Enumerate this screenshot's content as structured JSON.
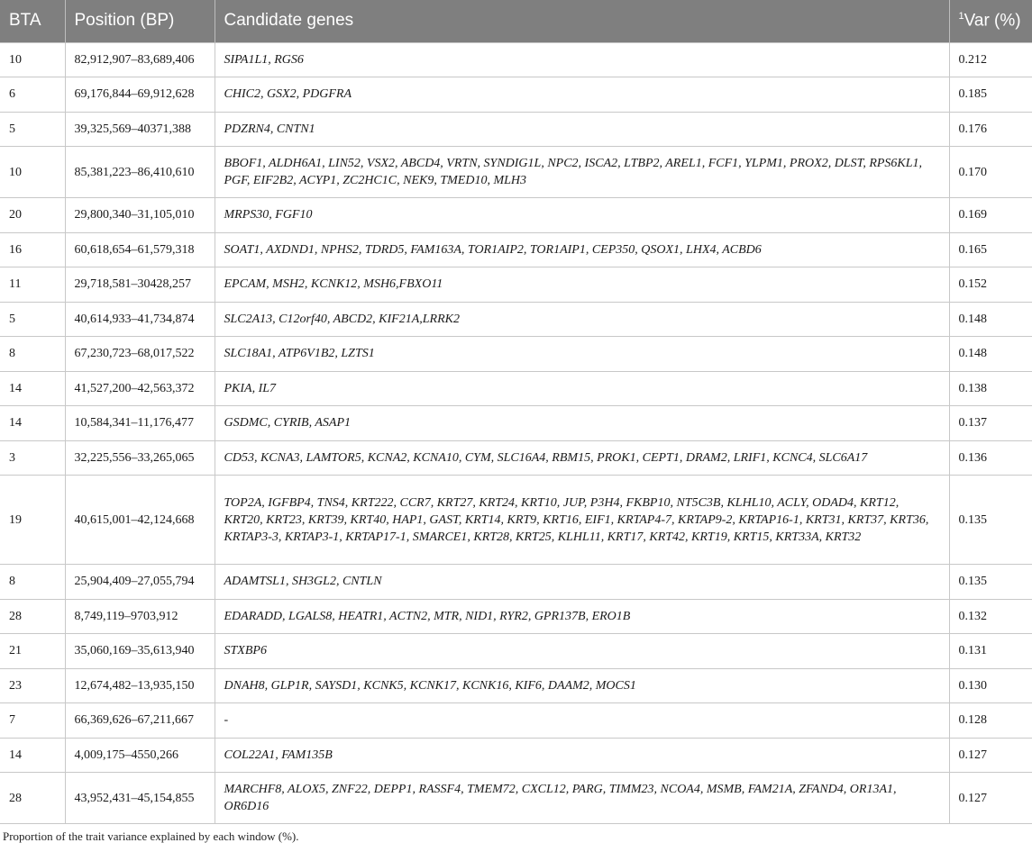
{
  "table": {
    "headers": {
      "bta": "BTA",
      "position": "Position (BP)",
      "genes": "Candidate genes",
      "var_sup": "1",
      "var": "Var (%)"
    },
    "rows": [
      {
        "bta": "10",
        "position": "82,912,907–83,689,406",
        "genes": "SIPA1L1, RGS6",
        "var": "0.212"
      },
      {
        "bta": "6",
        "position": "69,176,844–69,912,628",
        "genes": "CHIC2, GSX2, PDGFRA",
        "var": "0.185"
      },
      {
        "bta": "5",
        "position": "39,325,569–40371,388",
        "genes": "PDZRN4, CNTN1",
        "var": "0.176"
      },
      {
        "bta": "10",
        "position": "85,381,223–86,410,610",
        "genes": "BBOF1, ALDH6A1, LIN52, VSX2, ABCD4, VRTN, SYNDIG1L, NPC2, ISCA2, LTBP2, AREL1, FCF1, YLPM1, PROX2, DLST, RPS6KL1, PGF, EIF2B2, ACYP1, ZC2HC1C, NEK9, TMED10, MLH3",
        "var": "0.170"
      },
      {
        "bta": "20",
        "position": "29,800,340–31,105,010",
        "genes": "MRPS30, FGF10",
        "var": "0.169"
      },
      {
        "bta": "16",
        "position": "60,618,654–61,579,318",
        "genes": "SOAT1, AXDND1, NPHS2, TDRD5, FAM163A, TOR1AIP2, TOR1AIP1, CEP350, QSOX1, LHX4, ACBD6",
        "var": "0.165"
      },
      {
        "bta": "11",
        "position": "29,718,581–30428,257",
        "genes": "EPCAM, MSH2, KCNK12, MSH6,FBXO11",
        "var": "0.152"
      },
      {
        "bta": "5",
        "position": "40,614,933–41,734,874",
        "genes": "SLC2A13, C12orf40, ABCD2, KIF21A,LRRK2",
        "var": "0.148"
      },
      {
        "bta": "8",
        "position": "67,230,723–68,017,522",
        "genes": "SLC18A1, ATP6V1B2, LZTS1",
        "var": "0.148"
      },
      {
        "bta": "14",
        "position": "41,527,200–42,563,372",
        "genes": "PKIA, IL7",
        "var": "0.138"
      },
      {
        "bta": "14",
        "position": "10,584,341–11,176,477",
        "genes": "GSDMC, CYRIB, ASAP1",
        "var": "0.137"
      },
      {
        "bta": "3",
        "position": "32,225,556–33,265,065",
        "genes": "CD53, KCNA3, LAMTOR5, KCNA2, KCNA10, CYM, SLC16A4, RBM15, PROK1, CEPT1, DRAM2, LRIF1, KCNC4, SLC6A17",
        "var": "0.136"
      },
      {
        "bta": "19",
        "position": "40,615,001–42,124,668",
        "genes": "TOP2A, IGFBP4, TNS4, KRT222, CCR7, KRT27, KRT24, KRT10, JUP, P3H4, FKBP10, NT5C3B, KLHL10, ACLY, ODAD4, KRT12, KRT20, KRT23, KRT39, KRT40, HAP1, GAST, KRT14, KRT9, KRT16, EIF1, KRTAP4-7, KRTAP9-2, KRTAP16-1, KRT31, KRT37, KRT36, KRTAP3-3, KRTAP3-1, KRTAP17-1, SMARCE1, KRT28, KRT25, KLHL11, KRT17, KRT42, KRT19, KRT15, KRT33A, KRT32",
        "var": "0.135"
      },
      {
        "bta": "8",
        "position": "25,904,409–27,055,794",
        "genes": "ADAMTSL1, SH3GL2, CNTLN",
        "var": "0.135"
      },
      {
        "bta": "28",
        "position": "8,749,119–9703,912",
        "genes": "EDARADD, LGALS8, HEATR1, ACTN2, MTR, NID1, RYR2, GPR137B, ERO1B",
        "var": "0.132"
      },
      {
        "bta": "21",
        "position": "35,060,169–35,613,940",
        "genes": "STXBP6",
        "var": "0.131"
      },
      {
        "bta": "23",
        "position": "12,674,482–13,935,150",
        "genes": "DNAH8, GLP1R, SAYSD1, KCNK5, KCNK17, KCNK16, KIF6, DAAM2, MOCS1",
        "var": "0.130"
      },
      {
        "bta": "7",
        "position": "66,369,626–67,211,667",
        "genes": "-",
        "var": "0.128"
      },
      {
        "bta": "14",
        "position": "4,009,175–4550,266",
        "genes": "COL22A1, FAM135B",
        "var": "0.127"
      },
      {
        "bta": "28",
        "position": "43,952,431–45,154,855",
        "genes": "MARCHF8, ALOX5, ZNF22, DEPP1, RASSF4, TMEM72, CXCL12, PARG, TIMM23, NCOA4, MSMB, FAM21A, ZFAND4, OR13A1, OR6D16",
        "var": "0.127"
      }
    ]
  },
  "footnote": "Proportion of the trait variance explained by each window (%)."
}
